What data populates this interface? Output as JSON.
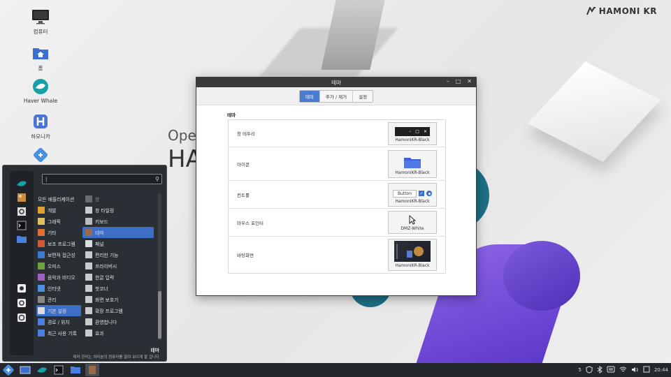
{
  "brand": {
    "text": "HAMONI KR"
  },
  "wallpaper": {
    "text_small": "Ope",
    "text_big": "HA"
  },
  "desktop_icons": [
    {
      "label": "컴퓨터",
      "icon": "computer-icon"
    },
    {
      "label": "홈",
      "icon": "home-folder-icon"
    },
    {
      "label": "Haver Whale",
      "icon": "whale-browser-icon"
    },
    {
      "label": "하모니카",
      "icon": "harmonica-icon"
    },
    {
      "label": "",
      "icon": "app-icon"
    }
  ],
  "window": {
    "title": "테마",
    "tabs": [
      "테마",
      "추가 / 제거",
      "설정"
    ],
    "active_tab": 0,
    "section_title": "테마",
    "rows": [
      {
        "label": "창 테두리",
        "preview": "HamoniKR-Black"
      },
      {
        "label": "아이콘",
        "preview": "HamoniKR-Black"
      },
      {
        "label": "컨트롤",
        "preview": "HamoniKR-Black",
        "button_label": "Button"
      },
      {
        "label": "마우스 포인터",
        "preview": "DMZ-White"
      },
      {
        "label": "바탕화면",
        "preview": "HamoniKR-Black"
      }
    ]
  },
  "menu": {
    "search_value": "|",
    "categories": [
      "모든 애플리케이션",
      "개발",
      "그래픽",
      "기타",
      "보조 프로그램",
      "보편적 접근성",
      "오피스",
      "음악과 비디오",
      "인터넷",
      "관리",
      "기본 설정",
      "경로 / 위치",
      "최근 사용 기록"
    ],
    "active_category": 10,
    "apps": [
      "창",
      "창 타일링",
      "키보드",
      "테마",
      "패널",
      "편리한 기능",
      "프라이버시",
      "한글 입력",
      "핫코너",
      "화면 보호기",
      "확장 프로그램",
      "환영합니다",
      "효과"
    ],
    "active_app": 3,
    "footer_title": "테마",
    "footer_desc": "테마 관리는 여러분의 컴퓨터를 알려 보이게 할 겁니다"
  },
  "taskbar": {
    "clock": "20:44",
    "tray_number": "5"
  }
}
